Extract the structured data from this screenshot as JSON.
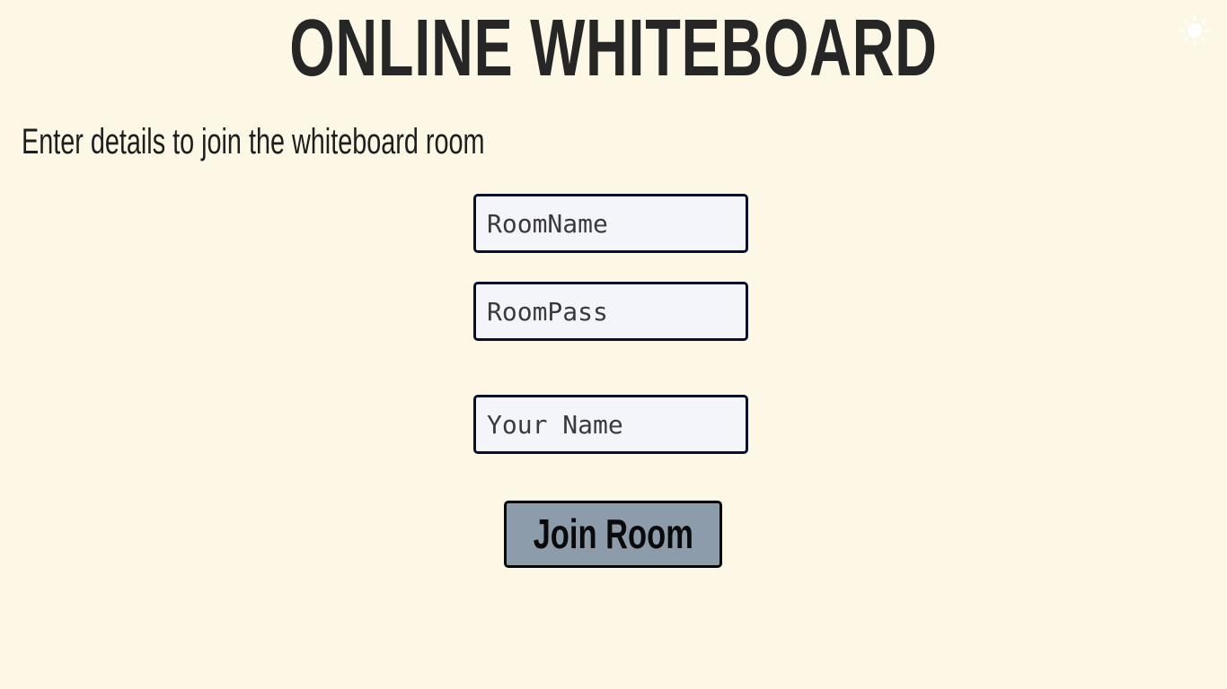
{
  "header": {
    "title": "ONLINE WHITEBOARD",
    "theme_toggle_icon": "sun-icon"
  },
  "form": {
    "instructions": "Enter details to join the whiteboard room",
    "room_name": {
      "placeholder": "RoomName",
      "value": ""
    },
    "room_pass": {
      "placeholder": "RoomPass",
      "value": ""
    },
    "your_name": {
      "placeholder": "Your Name",
      "value": ""
    },
    "join_label": "Join Room"
  },
  "colors": {
    "background": "#fdf8e6",
    "input_border": "#0b0f2e",
    "input_background": "#f4f5fa",
    "button_background": "#8d9caa"
  }
}
